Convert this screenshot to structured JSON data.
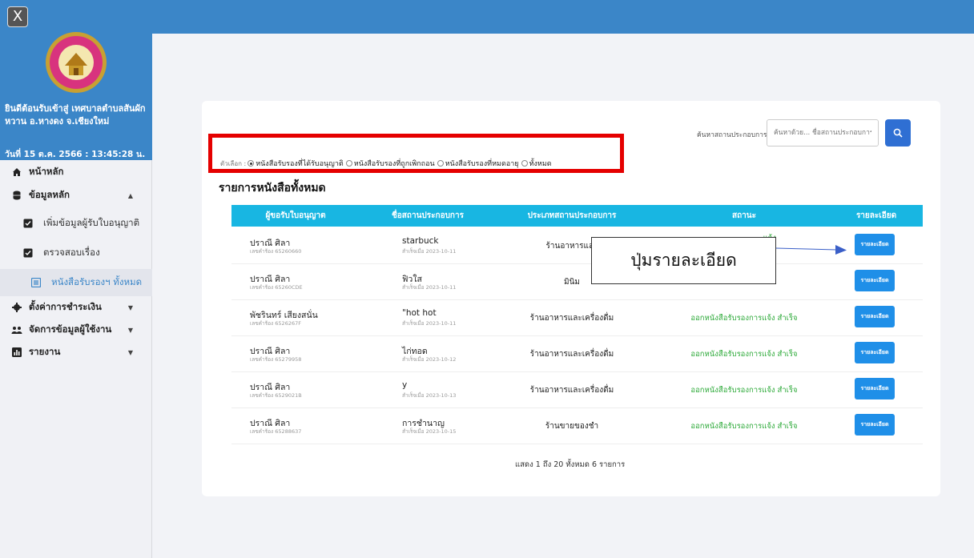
{
  "sidebar": {
    "close": "X",
    "welcome": "ยินดีต้อนรับเข้าสู่ เทศบาลตำบลสันผักหวาน อ.หางดง จ.เชียงใหม่",
    "datetime": "วันที่ 15 ต.ค. 2566 : 13:45:28 น.",
    "items": [
      {
        "label": "หน้าหลัก",
        "icon": "home-icon"
      },
      {
        "label": "ข้อมูลหลัก",
        "icon": "database-icon"
      },
      {
        "label": "เพิ่มข้อมูลผู้รับใบอนุญาติ",
        "icon": "checkbox-icon"
      },
      {
        "label": "ตรวจสอบเรื่อง",
        "icon": "checkbox-icon"
      },
      {
        "label": "หนังสือรับรองฯ ทั้งหมด",
        "icon": "list-icon"
      },
      {
        "label": "ตั้งค่าการชำระเงิน",
        "icon": "gear-icon"
      },
      {
        "label": "จัดการข้อมูลผู้ใช้งาน",
        "icon": "users-icon"
      },
      {
        "label": "รายงาน",
        "icon": "chart-icon"
      }
    ]
  },
  "search": {
    "label": "ค้นหาสถานประกอบการ",
    "placeholder": "ค้นหาด้วย... ชื่อสถานประกอบการ"
  },
  "filters": {
    "label": "ตัวเลือก :",
    "options": [
      {
        "label": "หนังสือรับรองที่ได้รับอนุญาติ",
        "selected": true
      },
      {
        "label": "หนังสือรับรองที่ถูกเพิกถอน",
        "selected": false
      },
      {
        "label": "หนังสือรับรองที่หมดอายุ",
        "selected": false
      },
      {
        "label": "ทั้งหมด",
        "selected": false
      }
    ]
  },
  "list_title": "รายการหนังสือทั้งหมด",
  "table": {
    "headers": [
      "ผู้ขอรับใบอนุญาต",
      "ชื่อสถานประกอบการ",
      "ประเภทสถานประกอบการ",
      "สถานะ",
      "รายละเอียด"
    ],
    "rows": [
      {
        "name": "ปราณี ศิลา",
        "ref": "เลขคำร้อง 65260660",
        "shop": "starbuck",
        "date": "สำเร็จเมื่อ 2023-10-11",
        "type": "ร้านอาหารและ",
        "status": "แจ้ง",
        "button": "รายละเอียด"
      },
      {
        "name": "ปราณี ศิลา",
        "ref": "เลขคำร้อง 65260CDE",
        "shop": "ฟิวใส",
        "date": "สำเร็จเมื่อ 2023-10-11",
        "type": "มินิม",
        "status": "แจ้ง",
        "button": "รายละเอียด"
      },
      {
        "name": "พัชรินทร์ เสียงสนั่น",
        "ref": "เลขคำร้อง 6526267F",
        "shop": "\"hot hot",
        "date": "สำเร็จเมื่อ 2023-10-11",
        "type": "ร้านอาหารและเครื่องดื่ม",
        "status": "ออกหนังสือรับรองการแจ้ง สำเร็จ",
        "button": "รายละเอียด"
      },
      {
        "name": "ปราณี ศิลา",
        "ref": "เลขคำร้อง 65279958",
        "shop": "ไก่ทอด",
        "date": "สำเร็จเมื่อ 2023-10-12",
        "type": "ร้านอาหารและเครื่องดื่ม",
        "status": "ออกหนังสือรับรองการแจ้ง สำเร็จ",
        "button": "รายละเอียด"
      },
      {
        "name": "ปราณี ศิลา",
        "ref": "เลขคำร้อง 6529021B",
        "shop": "y",
        "date": "สำเร็จเมื่อ 2023-10-13",
        "type": "ร้านอาหารและเครื่องดื่ม",
        "status": "ออกหนังสือรับรองการแจ้ง สำเร็จ",
        "button": "รายละเอียด"
      },
      {
        "name": "ปราณี ศิลา",
        "ref": "เลขคำร้อง 65288637",
        "shop": "การชำนาญ",
        "date": "สำเร็จเมื่อ 2023-10-15",
        "type": "ร้านขายของชำ",
        "status": "ออกหนังสือรับรองการแจ้ง สำเร็จ",
        "button": "รายละเอียด"
      }
    ]
  },
  "callout": "ปุ่มรายละเอียด",
  "footer": "แสดง 1 ถึง 20 ทั้งหมด 6 รายการ",
  "colors": {
    "primary": "#3b86c8",
    "table_header": "#18b6e2",
    "status_green": "#2eaa3a",
    "highlight_red": "#e50000",
    "button_blue": "#1f8fe8"
  }
}
